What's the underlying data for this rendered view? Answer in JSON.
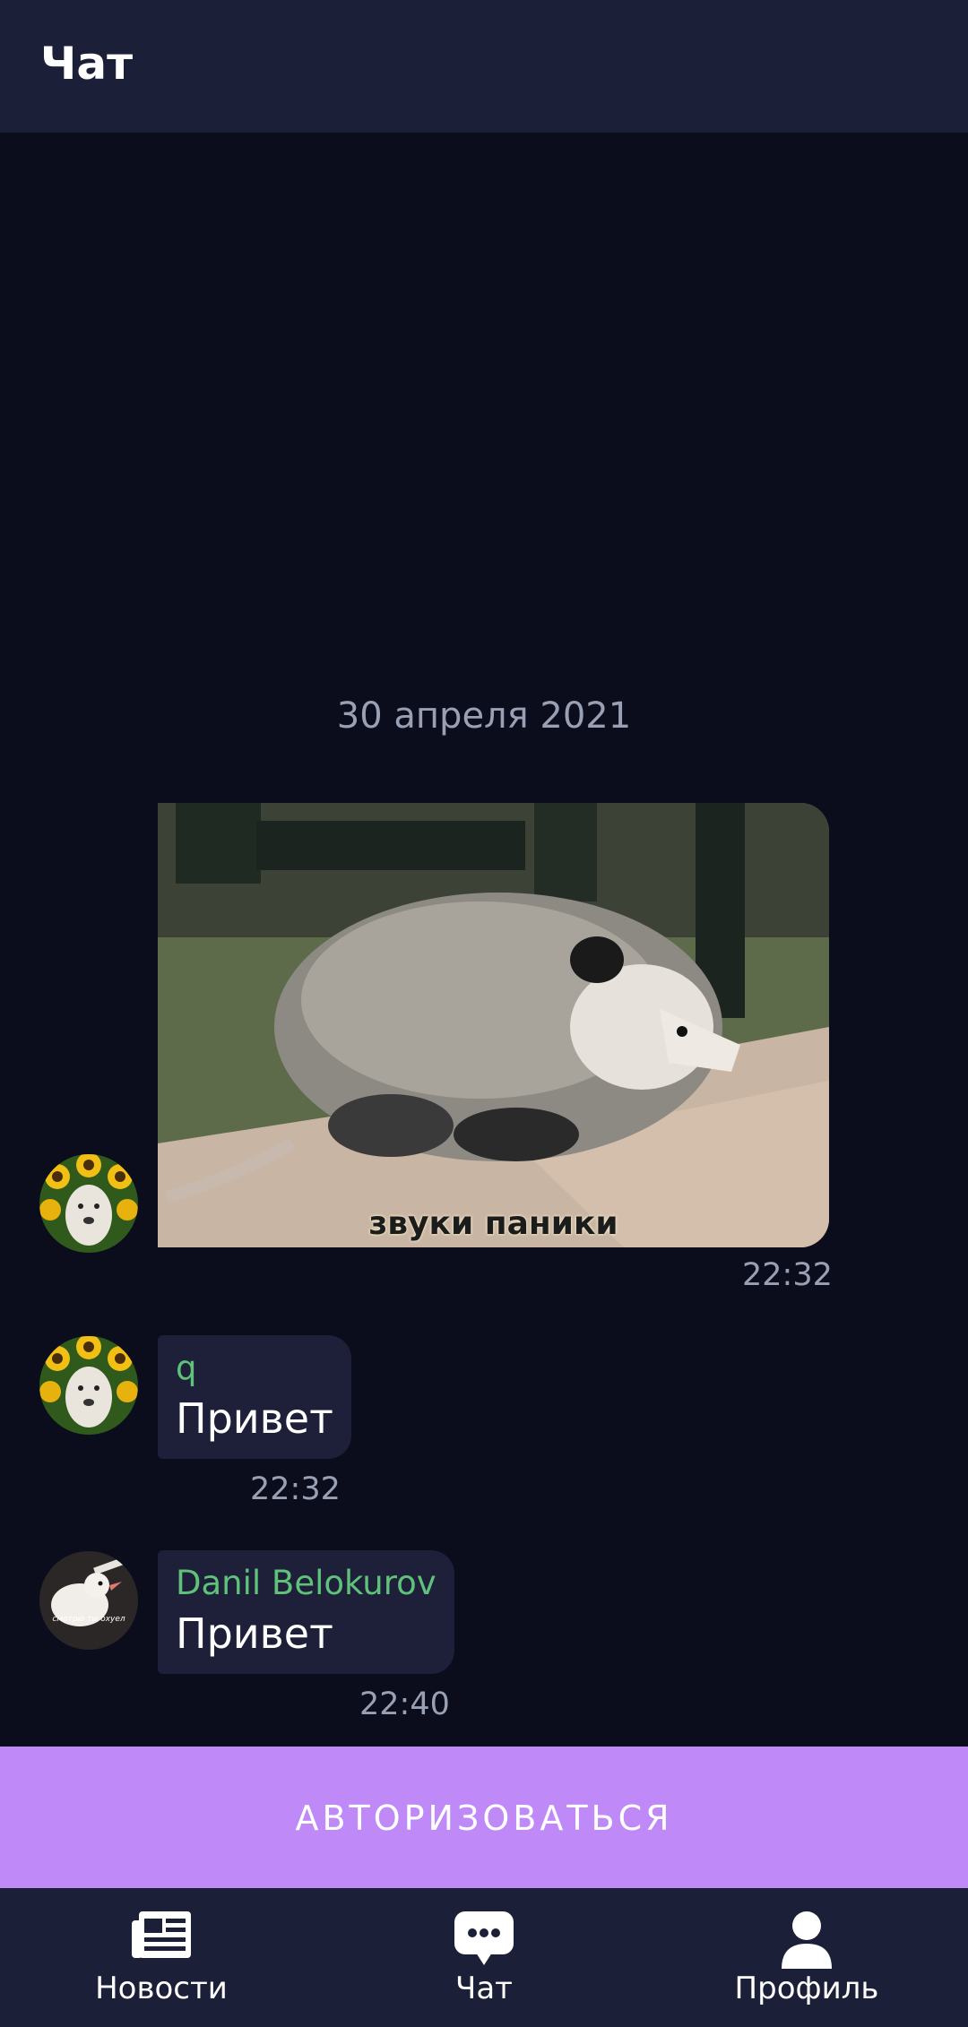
{
  "header": {
    "title": "Чат"
  },
  "chat": {
    "date_separator": "30 апреля 2021",
    "messages": [
      {
        "type": "image",
        "caption": "звуки паники",
        "time": "22:32",
        "avatar": "dog-sunflowers-avatar"
      },
      {
        "type": "text",
        "sender": "q",
        "text": "Привет",
        "time": "22:32",
        "avatar": "dog-sunflowers-avatar"
      },
      {
        "type": "text",
        "sender": "Danil Belokurov",
        "text": "Привет",
        "time": "22:40",
        "avatar": "bird-avatar"
      }
    ]
  },
  "auth_button": {
    "label": "АВТОРИЗОВАТЬСЯ"
  },
  "bottom_nav": {
    "items": [
      {
        "label": "Новости",
        "icon": "newspaper-icon"
      },
      {
        "label": "Чат",
        "icon": "chat-bubble-icon"
      },
      {
        "label": "Профиль",
        "icon": "person-icon"
      }
    ]
  },
  "colors": {
    "background": "#0b0d1c",
    "bar": "#1b1f37",
    "bubble": "#1d2038",
    "accent": "#bf8af8",
    "sender_name": "#5fc17a",
    "meta_text": "#9aa0b4"
  }
}
